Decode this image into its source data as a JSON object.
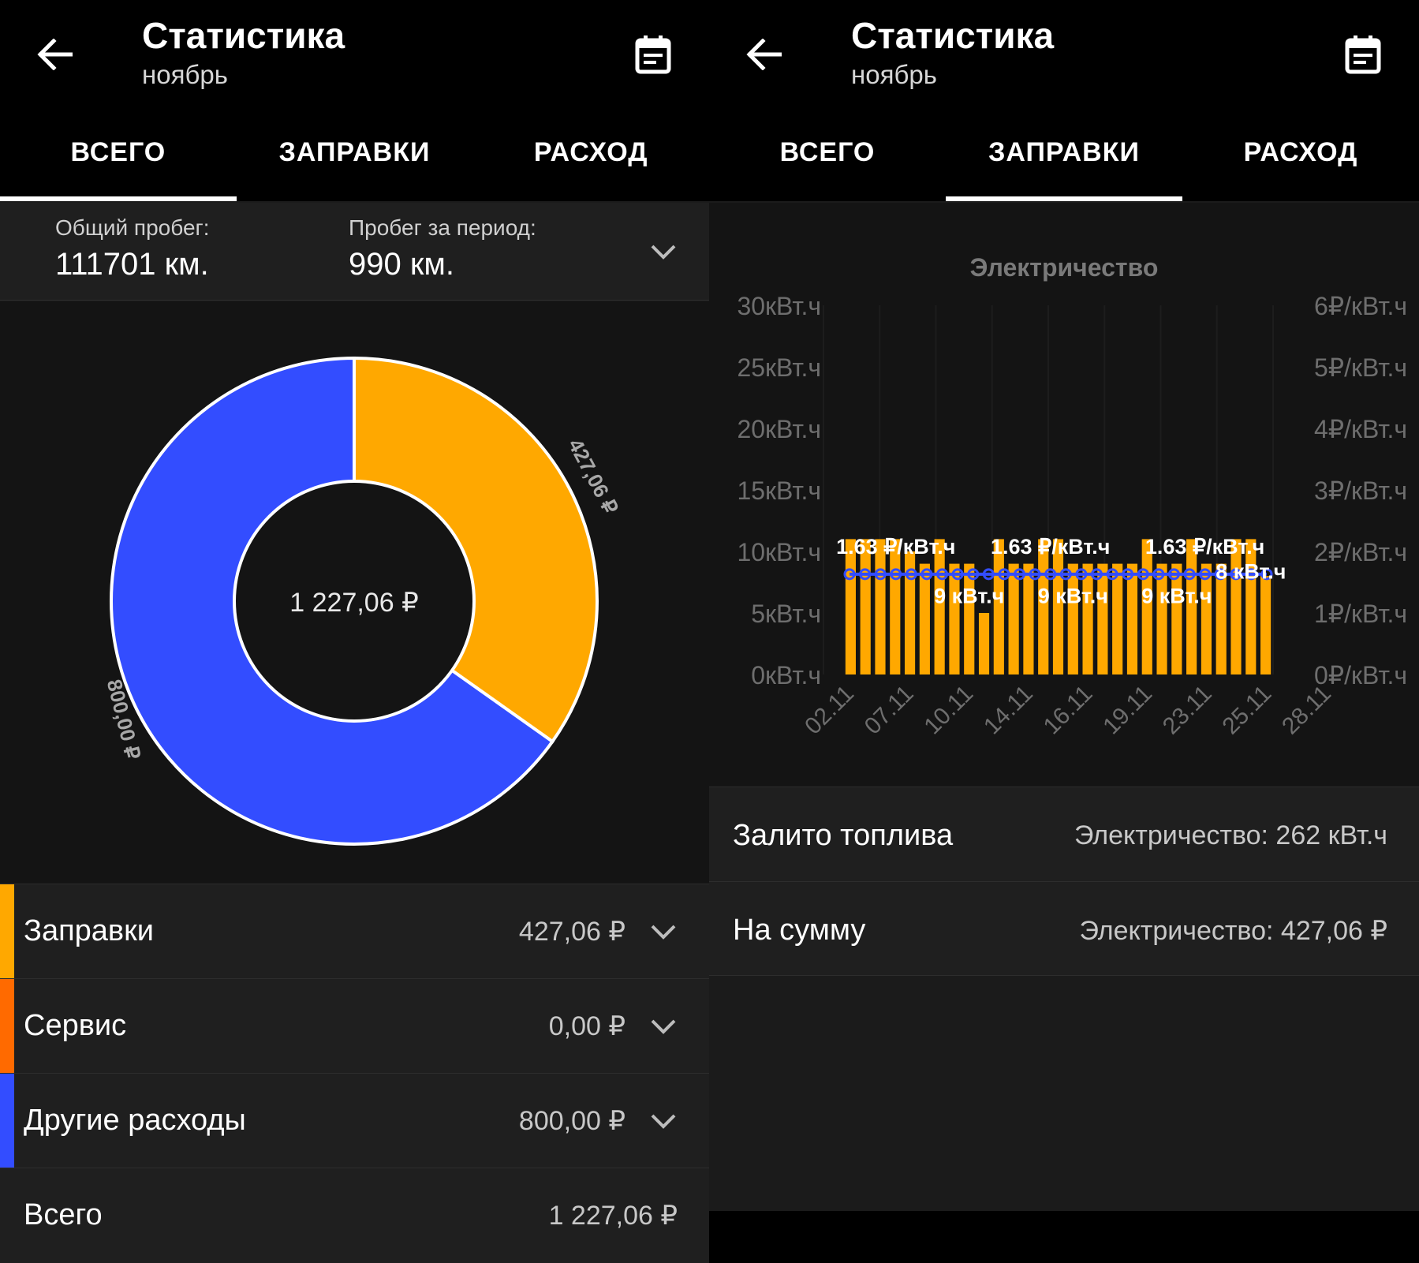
{
  "left": {
    "header": {
      "title": "Статистика",
      "subtitle": "ноябрь"
    },
    "tabs": [
      {
        "label": "ВСЕГО",
        "active": true
      },
      {
        "label": "ЗАПРАВКИ",
        "active": false
      },
      {
        "label": "РАСХОД",
        "active": false
      }
    ],
    "mileage": {
      "total_label": "Общий пробег:",
      "total_value": "111701 км.",
      "period_label": "Пробег за период:",
      "period_value": "990 км."
    },
    "donut": {
      "center_label": "1 227,06 ₽",
      "slices": [
        {
          "name": "Заправки",
          "value": 427.06,
          "label": "427,06 ₽",
          "color": "#FFA800"
        },
        {
          "name": "Другие расходы",
          "value": 800.0,
          "label": "800,00 ₽",
          "color": "#334DFF"
        }
      ]
    },
    "categories": [
      {
        "name": "Заправки",
        "amount": "427,06 ₽",
        "color": "#FFA800"
      },
      {
        "name": "Сервис",
        "amount": "0,00 ₽",
        "color": "#FF6A00"
      },
      {
        "name": "Другие расходы",
        "amount": "800,00 ₽",
        "color": "#334DFF"
      }
    ],
    "total": {
      "name": "Всего",
      "amount": "1 227,06 ₽"
    }
  },
  "right": {
    "header": {
      "title": "Статистика",
      "subtitle": "ноябрь"
    },
    "tabs": [
      {
        "label": "ВСЕГО",
        "active": false
      },
      {
        "label": "ЗАПРАВКИ",
        "active": true
      },
      {
        "label": "РАСХОД",
        "active": false
      }
    ],
    "info": {
      "fuel_label": "Залито топлива",
      "fuel_value": "Электричество: 262 кВт.ч",
      "sum_label": "На сумму",
      "sum_value": "Электричество: 427,06 ₽"
    }
  },
  "chart_data": {
    "type": "bar",
    "title": "Электричество",
    "bar_color": "#FFA800",
    "line_color": "#334DFF",
    "y_left": {
      "ticks": [
        "0кВт.ч",
        "5кВт.ч",
        "10кВт.ч",
        "15кВт.ч",
        "20кВт.ч",
        "25кВт.ч",
        "30кВт.ч"
      ],
      "ylim": [
        0,
        30
      ]
    },
    "y_right": {
      "ticks": [
        "0₽/кВт.ч",
        "1₽/кВт.ч",
        "2₽/кВт.ч",
        "3₽/кВт.ч",
        "4₽/кВт.ч",
        "5₽/кВт.ч",
        "6₽/кВт.ч"
      ],
      "ylim": [
        0,
        6
      ]
    },
    "x_tick_labels": [
      "02.11",
      "07.11",
      "10.11",
      "14.11",
      "16.11",
      "19.11",
      "23.11",
      "25.11",
      "28.11"
    ],
    "bars_kwh": [
      11,
      11,
      11,
      11,
      10,
      9,
      11,
      9,
      9,
      5,
      11,
      9,
      9,
      11,
      11,
      9,
      9,
      9,
      9,
      9,
      11,
      9,
      9,
      11,
      9,
      9,
      11,
      11,
      8
    ],
    "price_per_kwh": [
      1.63,
      1.63,
      1.63,
      1.63,
      1.63,
      1.63,
      1.63,
      1.63,
      1.63,
      1.63,
      1.63,
      1.63,
      1.63,
      1.63,
      1.63,
      1.63,
      1.63,
      1.63,
      1.63,
      1.63,
      1.63,
      1.63,
      1.63,
      1.63,
      1.63,
      1.63,
      1.63,
      1.63
    ],
    "price_labels": [
      {
        "index": 3,
        "text": "1.63 ₽/кВт.ч"
      },
      {
        "index": 13,
        "text": "1.63 ₽/кВт.ч"
      },
      {
        "index": 23,
        "text": "1.63 ₽/кВт.ч"
      }
    ],
    "value_labels": [
      {
        "index": 8,
        "text": "9 кВт.ч"
      },
      {
        "index": 15,
        "text": "9 кВт.ч"
      },
      {
        "index": 22,
        "text": "9 кВт.ч"
      },
      {
        "index": 27,
        "text": "8 кВт.ч"
      }
    ]
  }
}
